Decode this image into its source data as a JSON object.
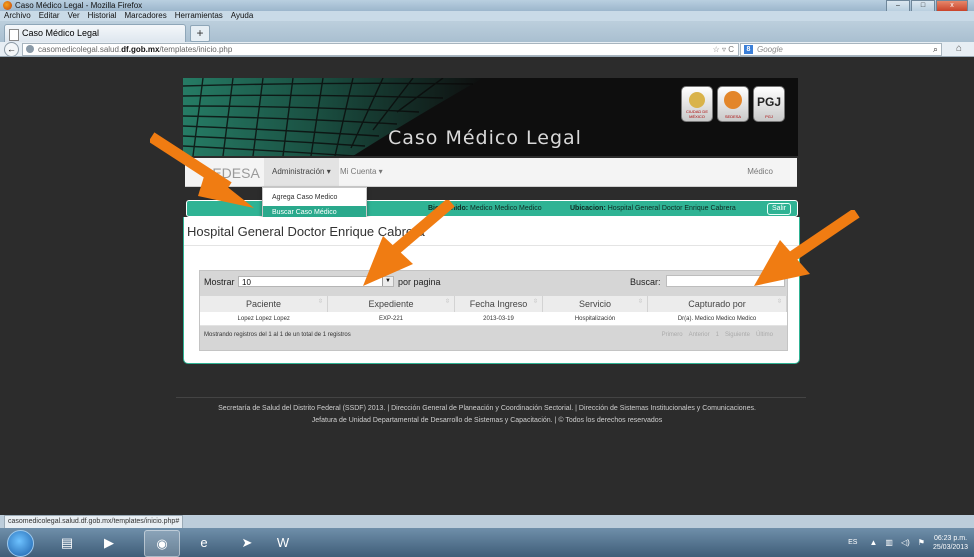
{
  "window": {
    "title": "Caso Médico Legal - Mozilla Firefox",
    "minimize": "–",
    "maximize": "□",
    "close": "x"
  },
  "menu": [
    "Archivo",
    "Editar",
    "Ver",
    "Historial",
    "Marcadores",
    "Herramientas",
    "Ayuda"
  ],
  "tab": {
    "label": "Caso Médico Legal",
    "new_tab": "+"
  },
  "nav": {
    "back": "←",
    "url_prefix": "casomedicolegal.salud.",
    "url_domain": "df.gob.mx",
    "url_suffix": "/templates/inicio.php",
    "url_controls": "☆ ▿ C",
    "search_engine": "8",
    "search_placeholder": "Google",
    "search_icon": "⌕",
    "home_icon": "⌂"
  },
  "site": {
    "title": "Caso Médico Legal",
    "logos": [
      {
        "icon": "emblem-icon",
        "caption": "CIUDAD DE MÉXICO"
      },
      {
        "icon": "sedesa-icon",
        "caption": "SEDESA"
      },
      {
        "icon": "pgj-icon",
        "label": "PGJ",
        "caption": "PGJ"
      }
    ],
    "brand": "SEDESA",
    "nav_admin": "Administración ▾",
    "nav_cuenta": "Mi Cuenta ▾",
    "nav_right": "Médico",
    "dropdown": [
      "Agrega Caso Medico",
      "Buscar Caso Médico"
    ],
    "welcome_label": "Bienvenido:",
    "welcome_value": " Medico Medico Medico",
    "ubicacion_label": "Ubicacion:",
    "ubicacion_value": " Hospital General Doctor Enrique Cabrera",
    "salir": "Salir",
    "hospital_title": "Hospital General Doctor Enrique Cabrera"
  },
  "table": {
    "show_label": "Mostrar",
    "show_value": "10",
    "per_page": "por pagina",
    "search_label": "Buscar:",
    "search_value": "",
    "columns": [
      "Paciente",
      "Expediente",
      "Fecha Ingreso",
      "Servicio",
      "Capturado por"
    ],
    "rows": [
      [
        "Lopez Lopez Lopez",
        "EXP-221",
        "2013-03-19",
        "Hospitalización",
        "Dr(a). Medico Medico Medico"
      ]
    ],
    "info": "Mostrando registros del 1 al 1 de un total de 1 registros",
    "pagination": [
      "Primero",
      "Anterior",
      "1",
      "Siguiente",
      "Último"
    ]
  },
  "footer": {
    "line1": "Secretaría de Salud del Distrito Federal (SSDF) 2013.  |  Dirección General de Planeación y Coordinación Sectorial.  |  Dirección de Sistemas Institucionales y Comunicaciones.",
    "line2": "Jefatura de Unidad Departamental de Desarrollo de Sistemas y Capacitación.  |  © Todos los derechos reservados"
  },
  "status_url": "casomedicolegal.salud.df.gob.mx/templates/inicio.php#",
  "taskbar": {
    "apps": [
      "explorer-icon",
      "media-player-icon",
      "firefox-icon",
      "ie-icon",
      "app-icon",
      "word-icon"
    ],
    "language": "ES",
    "time": "06:23 p.m.",
    "date": "25/03/2013"
  },
  "colors": {
    "accent": "#2fb394",
    "arrow": "#f07c12",
    "header": "#0e0e0e"
  }
}
